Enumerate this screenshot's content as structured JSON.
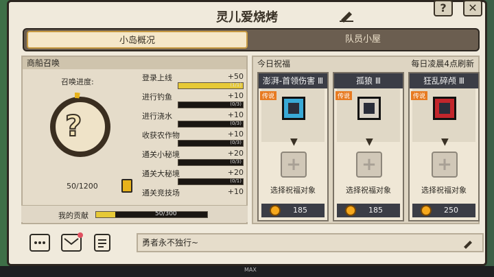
{
  "title": "灵儿爱烧烤",
  "tabs": [
    {
      "label": "小岛概况"
    },
    {
      "label": "队员小屋"
    }
  ],
  "left": {
    "section_title": "商船召唤",
    "progress_label": "召唤进度:",
    "count": "50/1200",
    "tasks": [
      {
        "name": "登录上线",
        "reward": "+50",
        "progress": "(1/1)",
        "fill": 1.0
      },
      {
        "name": "进行钓鱼",
        "reward": "+10",
        "progress": "(0/3)",
        "fill": 0.0
      },
      {
        "name": "进行浇水",
        "reward": "+10",
        "progress": "(0/3)",
        "fill": 0.0
      },
      {
        "name": "收获农作物",
        "reward": "+10",
        "progress": "(0/3)",
        "fill": 0.0
      },
      {
        "name": "通关小秘境",
        "reward": "+20",
        "progress": "(0/3)",
        "fill": 0.0
      },
      {
        "name": "通关大秘境",
        "reward": "+20",
        "progress": "(0/1)",
        "fill": 0.0
      },
      {
        "name": "通关竞技场",
        "reward": "+10",
        "progress": "",
        "fill": 0.0
      }
    ],
    "contribution_label": "我的贡献",
    "contribution_value": "50/300",
    "contribution_fill": 0.17
  },
  "right": {
    "title": "今日祝福",
    "refresh_note": "每日凌晨4点刷新",
    "cards": [
      {
        "title": "澎湃-首领伤害 Ⅲ",
        "badge": "传说",
        "choose": "选择祝福对象",
        "cost": "185",
        "icon_color": "#39a9d6"
      },
      {
        "title": "孤狼 Ⅲ",
        "badge": "传说",
        "choose": "选择祝福对象",
        "cost": "185",
        "icon_color": "#d9d2c7"
      },
      {
        "title": "狂乱碎颅 Ⅲ",
        "badge": "传说",
        "choose": "选择祝福对象",
        "cost": "250",
        "icon_color": "#c2262c"
      }
    ]
  },
  "bottom": {
    "motto": "勇者永不独行~"
  },
  "footer_max": "MAX",
  "colors": {
    "accent": "#e6c937",
    "badge": "#e77b22",
    "card_title_bg": "#3b3d46"
  }
}
